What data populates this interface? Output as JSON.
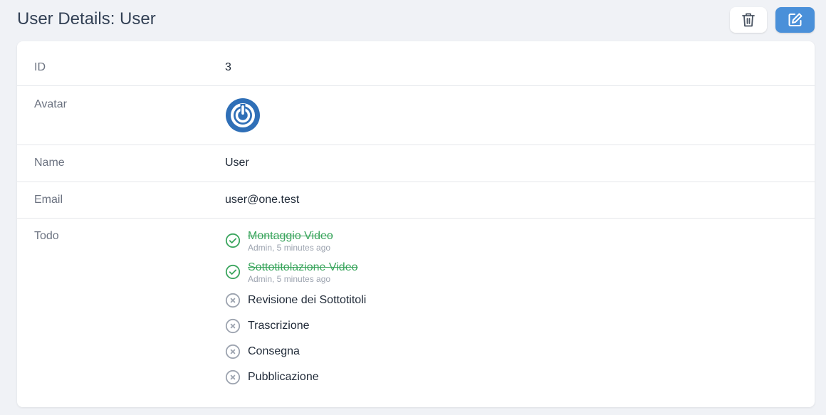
{
  "header": {
    "title": "User Details: User",
    "delete_icon": "trash-icon",
    "edit_icon": "edit-icon",
    "edit_color": "#4a90d9"
  },
  "fields": {
    "id": {
      "label": "ID",
      "value": "3"
    },
    "avatar": {
      "label": "Avatar",
      "icon": "power-avatar",
      "color": "#2f6fb7"
    },
    "name": {
      "label": "Name",
      "value": "User"
    },
    "email": {
      "label": "Email",
      "value": "user@one.test"
    },
    "todo": {
      "label": "Todo",
      "items": [
        {
          "title": "Montaggio Video",
          "meta": "Admin, 5 minutes ago",
          "done": true
        },
        {
          "title": "Sottotitolazione Video",
          "meta": "Admin, 5 minutes ago",
          "done": true
        },
        {
          "title": "Revisione dei Sottotitoli",
          "done": false
        },
        {
          "title": "Trascrizione",
          "done": false
        },
        {
          "title": "Consegna",
          "done": false
        },
        {
          "title": "Pubblicazione",
          "done": false
        }
      ]
    }
  },
  "colors": {
    "done": "#3aa55d",
    "pending": "#9ca3af"
  }
}
